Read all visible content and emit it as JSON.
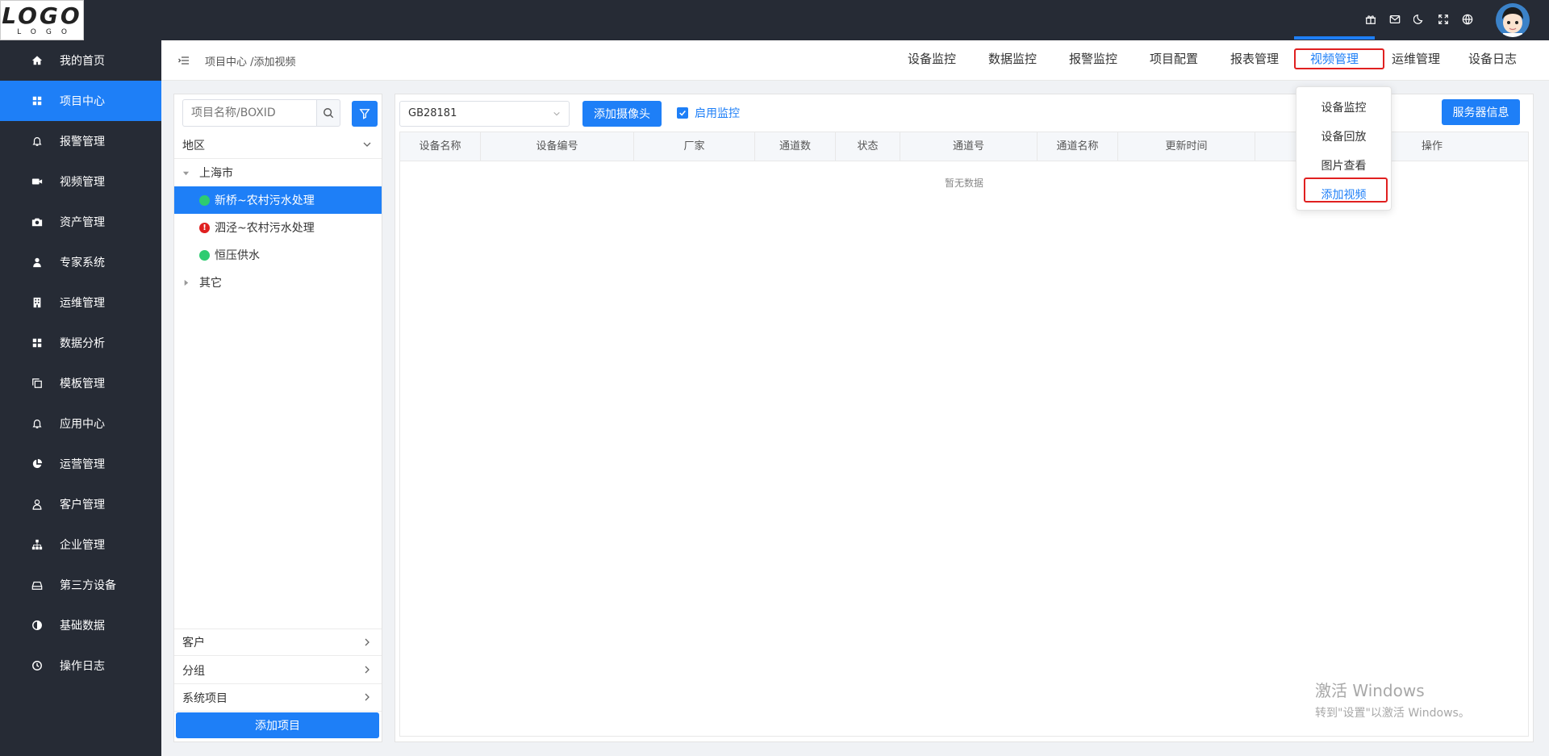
{
  "app": {
    "logo_main": "LOGO",
    "logo_sub": "LOGO"
  },
  "topbar": {
    "icons": [
      "gift-icon",
      "mail-icon",
      "moon-icon",
      "fullscreen-icon",
      "globe-icon"
    ]
  },
  "sidebar": {
    "items": [
      {
        "label": "我的首页",
        "icon": "home-icon"
      },
      {
        "label": "项目中心",
        "icon": "grid-icon",
        "active": true
      },
      {
        "label": "报警管理",
        "icon": "bell-icon"
      },
      {
        "label": "视频管理",
        "icon": "video-icon"
      },
      {
        "label": "资产管理",
        "icon": "camera-icon"
      },
      {
        "label": "专家系统",
        "icon": "user-icon"
      },
      {
        "label": "运维管理",
        "icon": "building-icon"
      },
      {
        "label": "数据分析",
        "icon": "grid-icon"
      },
      {
        "label": "模板管理",
        "icon": "copy-icon"
      },
      {
        "label": "应用中心",
        "icon": "bell-icon"
      },
      {
        "label": "运营管理",
        "icon": "pie-icon"
      },
      {
        "label": "客户管理",
        "icon": "person-icon"
      },
      {
        "label": "企业管理",
        "icon": "org-icon"
      },
      {
        "label": "第三方设备",
        "icon": "drive-icon"
      },
      {
        "label": "基础数据",
        "icon": "contrast-icon"
      },
      {
        "label": "操作日志",
        "icon": "clock-icon"
      }
    ]
  },
  "header": {
    "breadcrumb": "项目中心 /添加视频",
    "nav": [
      {
        "label": "设备监控"
      },
      {
        "label": "数据监控"
      },
      {
        "label": "报警监控"
      },
      {
        "label": "项目配置"
      },
      {
        "label": "报表管理"
      },
      {
        "label": "视频管理",
        "active": true
      },
      {
        "label": "运维管理"
      },
      {
        "label": "设备日志"
      }
    ]
  },
  "dropdown": {
    "items": [
      {
        "label": "设备监控"
      },
      {
        "label": "设备回放"
      },
      {
        "label": "图片查看"
      },
      {
        "label": "添加视频",
        "active": true
      }
    ]
  },
  "leftpanel": {
    "search_placeholder": "项目名称/BOXID",
    "region_label": "地区",
    "tree": {
      "city": "上海市",
      "projects": [
        {
          "label": "新桥~农村污水处理",
          "status": "green",
          "selected": true
        },
        {
          "label": "泗泾~农村污水处理",
          "status": "red"
        },
        {
          "label": "恒压供水",
          "status": "green"
        }
      ],
      "other": "其它"
    },
    "bottom_sections": [
      "客户",
      "分组",
      "系统项目"
    ],
    "add_project": "添加项目"
  },
  "main": {
    "protocol_select": "GB28181",
    "add_camera": "添加摄像头",
    "enable_monitor": "启用监控",
    "server_info": "服务器信息",
    "columns": [
      "设备名称",
      "设备编号",
      "厂家",
      "通道数",
      "状态",
      "通道号",
      "通道名称",
      "更新时间",
      "",
      "操作"
    ],
    "empty_text": "暂无数据"
  },
  "watermark": {
    "line1": "激活 Windows",
    "line2": "转到\"设置\"以激活 Windows。"
  },
  "colors": {
    "primary": "#1e7ff7",
    "dark": "#262b35",
    "highlight_border": "#e02020",
    "status_green": "#2ecc71",
    "status_red": "#e02020"
  }
}
